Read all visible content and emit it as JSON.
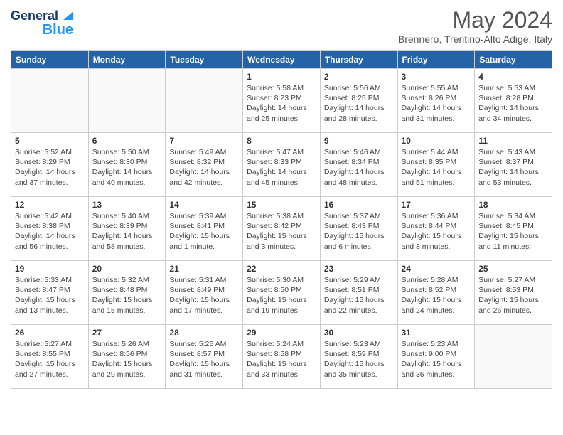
{
  "header": {
    "logo_line1": "General",
    "logo_line2": "Blue",
    "month": "May 2024",
    "location": "Brennero, Trentino-Alto Adige, Italy"
  },
  "days": [
    "Sunday",
    "Monday",
    "Tuesday",
    "Wednesday",
    "Thursday",
    "Friday",
    "Saturday"
  ],
  "weeks": [
    [
      {
        "date": "",
        "content": ""
      },
      {
        "date": "",
        "content": ""
      },
      {
        "date": "",
        "content": ""
      },
      {
        "date": "1",
        "content": "Sunrise: 5:58 AM\nSunset: 8:23 PM\nDaylight: 14 hours\nand 25 minutes."
      },
      {
        "date": "2",
        "content": "Sunrise: 5:56 AM\nSunset: 8:25 PM\nDaylight: 14 hours\nand 28 minutes."
      },
      {
        "date": "3",
        "content": "Sunrise: 5:55 AM\nSunset: 8:26 PM\nDaylight: 14 hours\nand 31 minutes."
      },
      {
        "date": "4",
        "content": "Sunrise: 5:53 AM\nSunset: 8:28 PM\nDaylight: 14 hours\nand 34 minutes."
      }
    ],
    [
      {
        "date": "5",
        "content": "Sunrise: 5:52 AM\nSunset: 8:29 PM\nDaylight: 14 hours\nand 37 minutes."
      },
      {
        "date": "6",
        "content": "Sunrise: 5:50 AM\nSunset: 8:30 PM\nDaylight: 14 hours\nand 40 minutes."
      },
      {
        "date": "7",
        "content": "Sunrise: 5:49 AM\nSunset: 8:32 PM\nDaylight: 14 hours\nand 42 minutes."
      },
      {
        "date": "8",
        "content": "Sunrise: 5:47 AM\nSunset: 8:33 PM\nDaylight: 14 hours\nand 45 minutes."
      },
      {
        "date": "9",
        "content": "Sunrise: 5:46 AM\nSunset: 8:34 PM\nDaylight: 14 hours\nand 48 minutes."
      },
      {
        "date": "10",
        "content": "Sunrise: 5:44 AM\nSunset: 8:35 PM\nDaylight: 14 hours\nand 51 minutes."
      },
      {
        "date": "11",
        "content": "Sunrise: 5:43 AM\nSunset: 8:37 PM\nDaylight: 14 hours\nand 53 minutes."
      }
    ],
    [
      {
        "date": "12",
        "content": "Sunrise: 5:42 AM\nSunset: 8:38 PM\nDaylight: 14 hours\nand 56 minutes."
      },
      {
        "date": "13",
        "content": "Sunrise: 5:40 AM\nSunset: 8:39 PM\nDaylight: 14 hours\nand 58 minutes."
      },
      {
        "date": "14",
        "content": "Sunrise: 5:39 AM\nSunset: 8:41 PM\nDaylight: 15 hours\nand 1 minute."
      },
      {
        "date": "15",
        "content": "Sunrise: 5:38 AM\nSunset: 8:42 PM\nDaylight: 15 hours\nand 3 minutes."
      },
      {
        "date": "16",
        "content": "Sunrise: 5:37 AM\nSunset: 8:43 PM\nDaylight: 15 hours\nand 6 minutes."
      },
      {
        "date": "17",
        "content": "Sunrise: 5:36 AM\nSunset: 8:44 PM\nDaylight: 15 hours\nand 8 minutes."
      },
      {
        "date": "18",
        "content": "Sunrise: 5:34 AM\nSunset: 8:45 PM\nDaylight: 15 hours\nand 11 minutes."
      }
    ],
    [
      {
        "date": "19",
        "content": "Sunrise: 5:33 AM\nSunset: 8:47 PM\nDaylight: 15 hours\nand 13 minutes."
      },
      {
        "date": "20",
        "content": "Sunrise: 5:32 AM\nSunset: 8:48 PM\nDaylight: 15 hours\nand 15 minutes."
      },
      {
        "date": "21",
        "content": "Sunrise: 5:31 AM\nSunset: 8:49 PM\nDaylight: 15 hours\nand 17 minutes."
      },
      {
        "date": "22",
        "content": "Sunrise: 5:30 AM\nSunset: 8:50 PM\nDaylight: 15 hours\nand 19 minutes."
      },
      {
        "date": "23",
        "content": "Sunrise: 5:29 AM\nSunset: 8:51 PM\nDaylight: 15 hours\nand 22 minutes."
      },
      {
        "date": "24",
        "content": "Sunrise: 5:28 AM\nSunset: 8:52 PM\nDaylight: 15 hours\nand 24 minutes."
      },
      {
        "date": "25",
        "content": "Sunrise: 5:27 AM\nSunset: 8:53 PM\nDaylight: 15 hours\nand 26 minutes."
      }
    ],
    [
      {
        "date": "26",
        "content": "Sunrise: 5:27 AM\nSunset: 8:55 PM\nDaylight: 15 hours\nand 27 minutes."
      },
      {
        "date": "27",
        "content": "Sunrise: 5:26 AM\nSunset: 8:56 PM\nDaylight: 15 hours\nand 29 minutes."
      },
      {
        "date": "28",
        "content": "Sunrise: 5:25 AM\nSunset: 8:57 PM\nDaylight: 15 hours\nand 31 minutes."
      },
      {
        "date": "29",
        "content": "Sunrise: 5:24 AM\nSunset: 8:58 PM\nDaylight: 15 hours\nand 33 minutes."
      },
      {
        "date": "30",
        "content": "Sunrise: 5:23 AM\nSunset: 8:59 PM\nDaylight: 15 hours\nand 35 minutes."
      },
      {
        "date": "31",
        "content": "Sunrise: 5:23 AM\nSunset: 9:00 PM\nDaylight: 15 hours\nand 36 minutes."
      },
      {
        "date": "",
        "content": ""
      }
    ]
  ]
}
